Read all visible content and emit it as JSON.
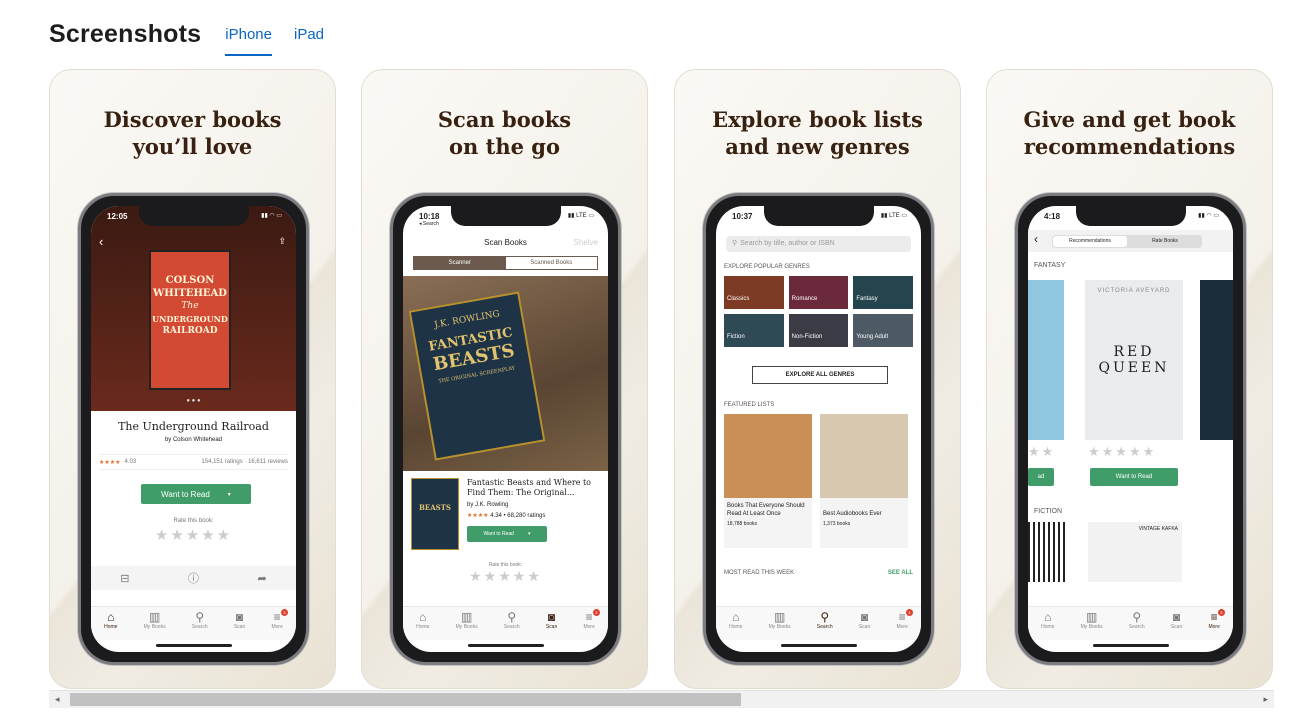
{
  "section": {
    "title": "Screenshots",
    "tabs": [
      {
        "label": "iPhone"
      },
      {
        "label": "iPad"
      }
    ]
  },
  "cards": [
    {
      "title": "Discover books\nyou’ll love",
      "phone": {
        "time": "12:05",
        "book_title": "The Underground Railroad",
        "book_author": "by Colson Whitehead",
        "cover_lines": [
          "COLSON",
          "WHITEHEAD",
          "The",
          "UNDERGROUND",
          "RAILROAD"
        ],
        "rating": "4.03",
        "ratings_count": "154,151 ratings · 16,611 reviews",
        "cta": "Want to Read",
        "rate_label": "Rate this book:",
        "tabs": [
          "Home",
          "My Books",
          "Search",
          "Scan",
          "More"
        ],
        "badge": "3"
      }
    },
    {
      "title": "Scan books\non the go",
      "phone": {
        "time": "10:18",
        "back": "◂ Search",
        "nav_title": "Scan Books",
        "nav_right": "Shelve",
        "segments": [
          "Scanner",
          "Scanned Books"
        ],
        "cover_text": [
          "J.K. ROWLING",
          "FANTASTIC",
          "BEASTS",
          "THE ORIGINAL SCREENPLAY"
        ],
        "book_title": "Fantastic Beasts and Where to Find Them: The Original...",
        "book_author": "by J.K. Rowling",
        "rating": "4.34 • 68,280 ratings",
        "cta": "Want to Read",
        "rate_label": "Rate this book:",
        "tabs": [
          "Home",
          "My Books",
          "Search",
          "Scan",
          "More"
        ],
        "badge": "2"
      }
    },
    {
      "title": "Explore book lists\nand new genres",
      "phone": {
        "time": "10:37",
        "search_placeholder": "Search by title, author or ISBN",
        "genres_header": "EXPLORE POPULAR GENRES",
        "genres": [
          "Classics",
          "Romance",
          "Fantasy",
          "Fiction",
          "Non-Fiction",
          "Young Adult"
        ],
        "explore_btn": "EXPLORE ALL GENRES",
        "featured_header": "FEATURED LISTS",
        "lists": [
          {
            "title": "Books That Everyone Should Read At Least Once",
            "count": "18,788 books"
          },
          {
            "title": "Best Audiobooks Ever",
            "count": "1,373 books"
          }
        ],
        "most_read": "MOST READ THIS WEEK",
        "see_all": "SEE ALL",
        "tabs": [
          "Home",
          "My Books",
          "Search",
          "Scan",
          "More"
        ],
        "badge": "3"
      }
    },
    {
      "title": "Give and get book\nrecommendations",
      "phone": {
        "time": "4:18",
        "segments": [
          "Recommendations",
          "Rate Books"
        ],
        "fantasy": "FANTASY",
        "author": "VICTORIA AVEYARD",
        "cover_title": [
          "RED",
          "QUEEN"
        ],
        "cta": "Want to Read",
        "cta_left": "ad",
        "fiction": "FICTION",
        "kafka": "VINTAGE KAFKA",
        "tabs": [
          "Home",
          "My Books",
          "Search",
          "Scan",
          "More"
        ],
        "badge": "3"
      }
    }
  ],
  "scrollbar": {
    "left_arrow": "◂",
    "right_arrow": "▸"
  }
}
